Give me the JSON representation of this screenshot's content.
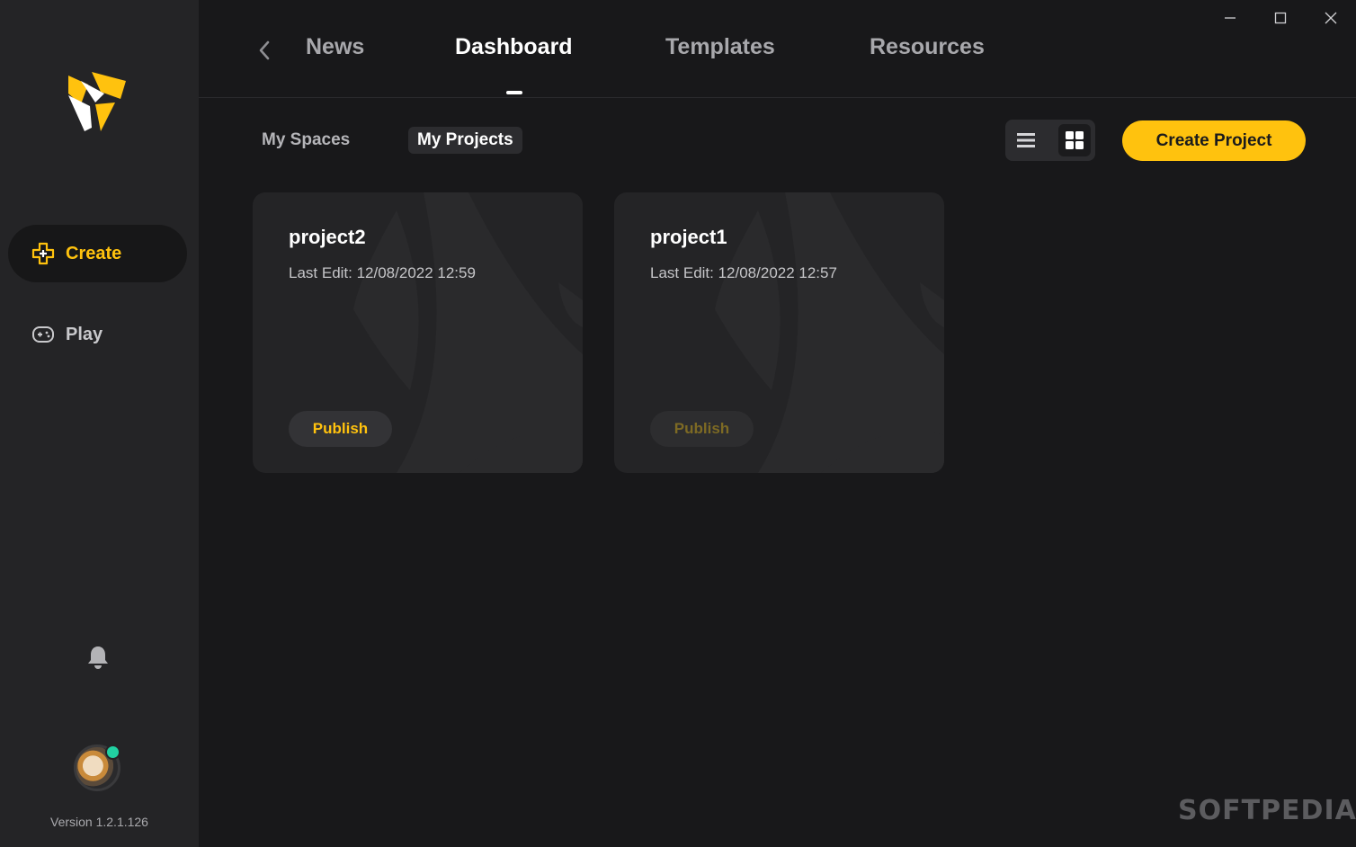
{
  "app": {
    "version": "Version 1.2.1.126",
    "brand_color": "#ffc20e"
  },
  "sidebar": {
    "items": [
      {
        "label": "Create",
        "icon": "create-plus-icon",
        "active": true
      },
      {
        "label": "Play",
        "icon": "gamepad-icon",
        "active": false
      }
    ],
    "notifications_icon": "bell-icon",
    "avatar_status": "online"
  },
  "header": {
    "tabs": [
      {
        "label": "News"
      },
      {
        "label": "Dashboard",
        "active": true
      },
      {
        "label": "Templates"
      },
      {
        "label": "Resources"
      }
    ]
  },
  "dashboard": {
    "subtabs": [
      {
        "label": "My Spaces"
      },
      {
        "label": "My Projects",
        "active": true
      }
    ],
    "view_mode": "grid",
    "create_project_label": "Create Project"
  },
  "projects": [
    {
      "name": "project2",
      "last_edit": "Last Edit: 12/08/2022 12:59",
      "publish_label": "Publish",
      "publish_enabled": true
    },
    {
      "name": "project1",
      "last_edit": "Last Edit: 12/08/2022 12:57",
      "publish_label": "Publish",
      "publish_enabled": false
    }
  ],
  "watermark": "SOFTPEDIA"
}
